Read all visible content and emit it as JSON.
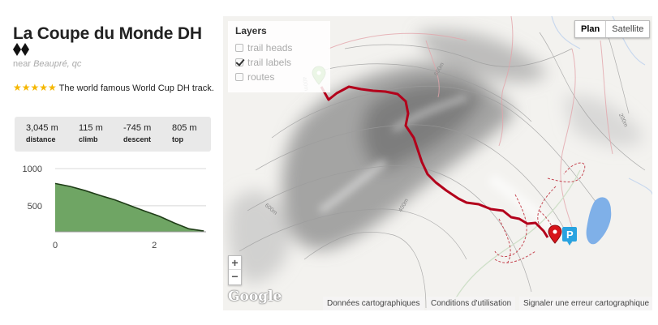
{
  "trail": {
    "title": "La Coupe du Monde DH",
    "location_prefix": "near",
    "location": "Beaupré, qc",
    "stars": "★★★★★",
    "description": "The world famous World Cup DH track.",
    "difficulty_icon": "double-black-diamond-icon"
  },
  "stats": [
    {
      "value": "3,045 m",
      "label": "distance"
    },
    {
      "value": "115 m",
      "label": "climb"
    },
    {
      "value": "-745 m",
      "label": "descent"
    },
    {
      "value": "805 m",
      "label": "top"
    }
  ],
  "chart_data": {
    "type": "area",
    "title": "",
    "xlabel": "",
    "ylabel": "",
    "yticks": [
      "1000",
      "500"
    ],
    "xticks": [
      "0",
      "2"
    ],
    "xlim": [
      0,
      3.045
    ],
    "ylim": [
      150,
      1000
    ],
    "x": [
      0,
      0.3,
      0.6,
      0.9,
      1.2,
      1.5,
      1.8,
      2.1,
      2.4,
      2.7,
      3.0
    ],
    "y": [
      800,
      760,
      705,
      640,
      580,
      505,
      430,
      360,
      270,
      190,
      160
    ],
    "fill_color": "#6fa564",
    "line_color": "#1f3d17"
  },
  "map": {
    "layers_title": "Layers",
    "layers": [
      {
        "label": "trail heads",
        "checked": false
      },
      {
        "label": "trail labels",
        "checked": true
      },
      {
        "label": "routes",
        "checked": false
      }
    ],
    "map_types": [
      "Plan",
      "Satellite"
    ],
    "zoom_in": "+",
    "zoom_out": "−",
    "logo": "Google",
    "attribution": [
      "Données cartographiques",
      "Conditions d'utilisation",
      "Signaler une erreur cartographique"
    ],
    "contour_labels": [
      "600m",
      "400m",
      "400m",
      "600m",
      "200m"
    ],
    "parking_label": "P",
    "route_color": "#b3001b"
  }
}
